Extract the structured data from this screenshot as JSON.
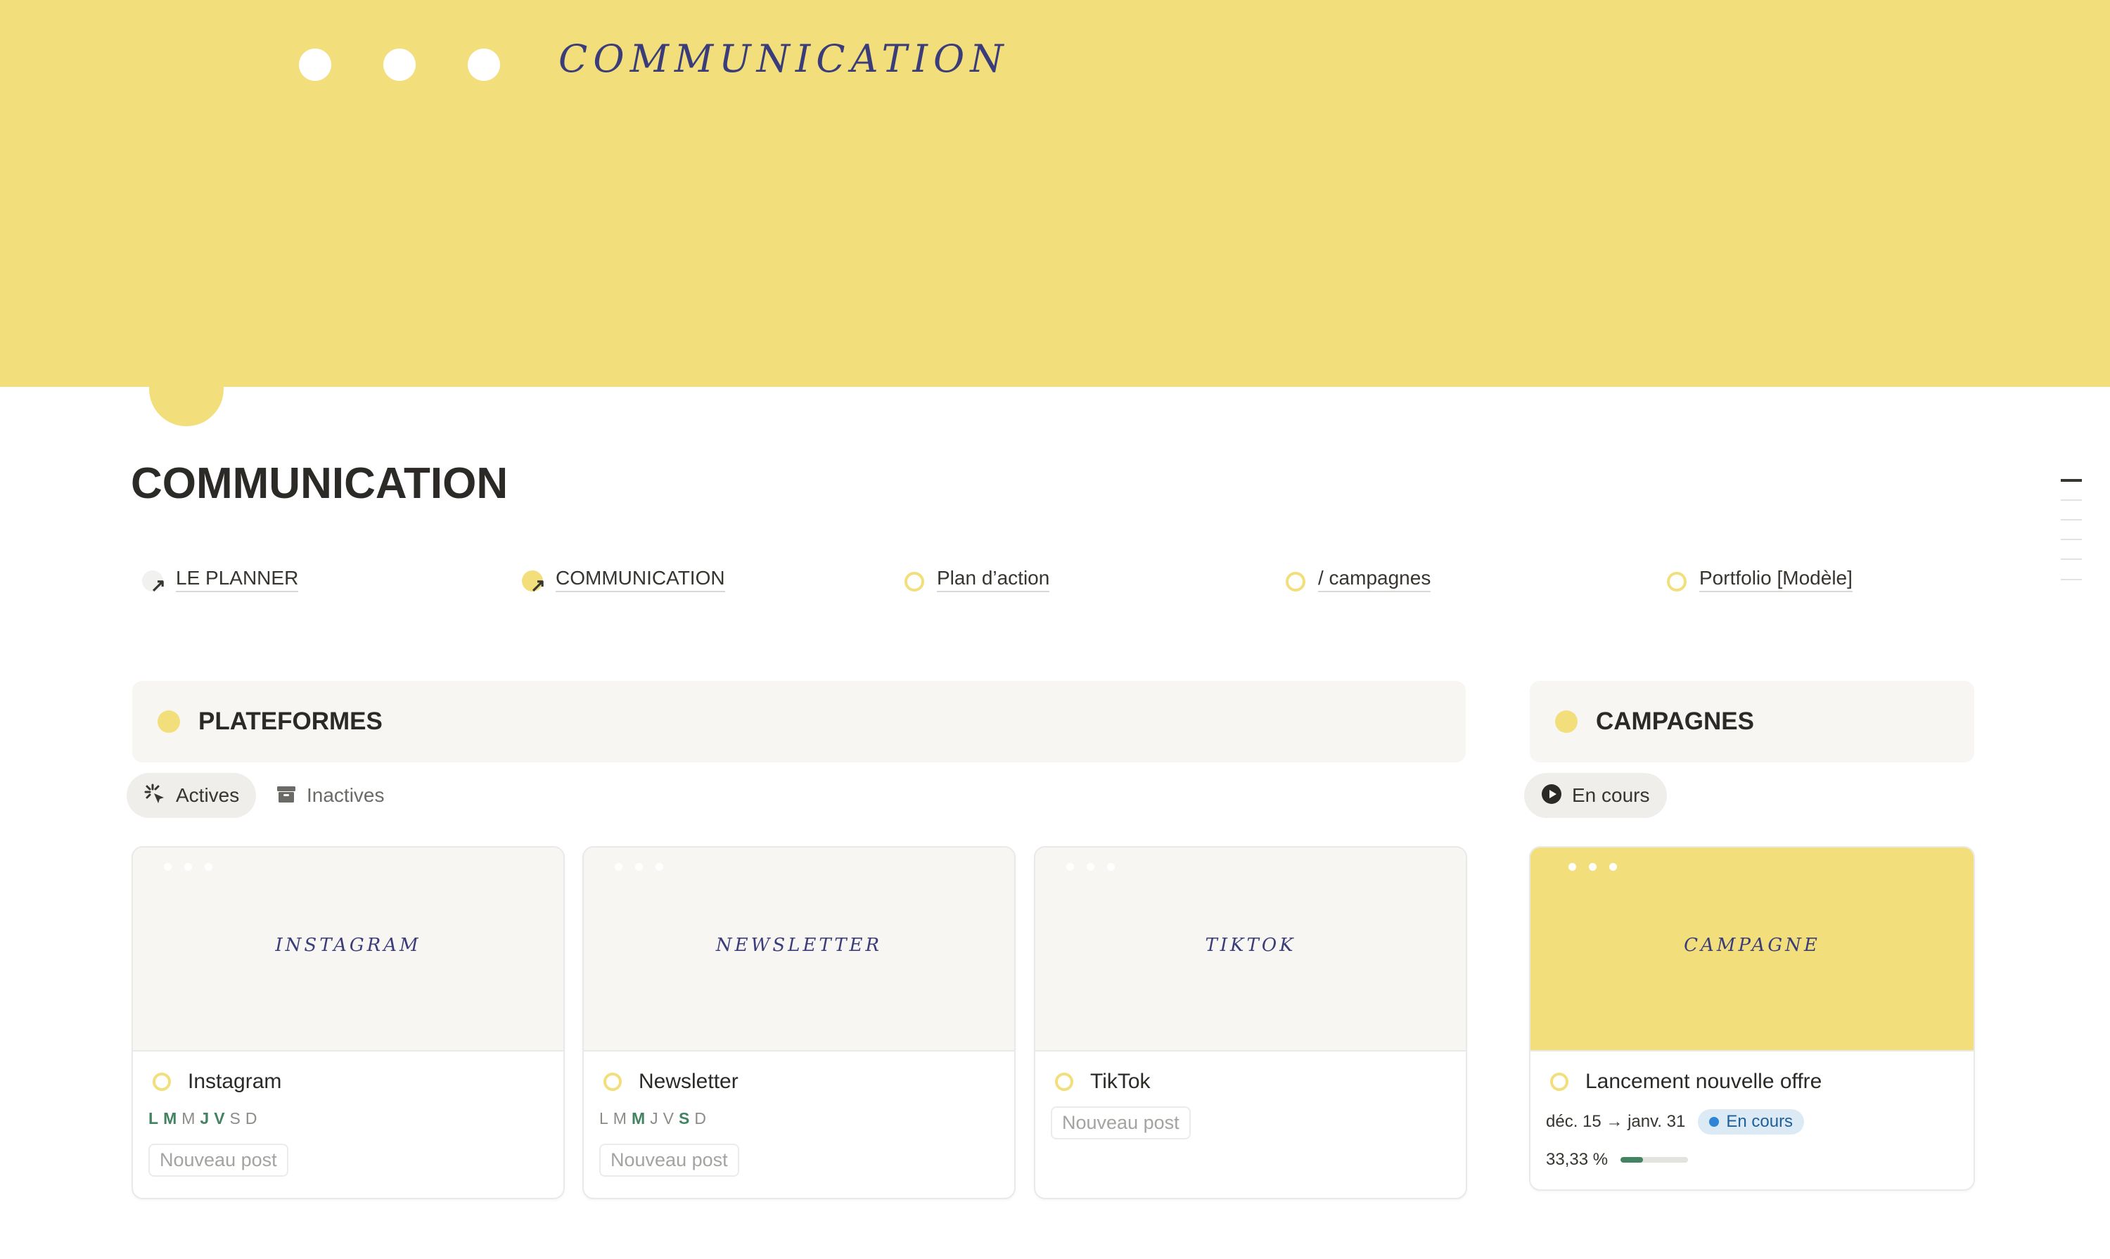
{
  "cover": {
    "title": "COMMUNICATION",
    "color": "#f2df7c"
  },
  "page": {
    "title": "COMMUNICATION"
  },
  "links": [
    {
      "label": "LE PLANNER",
      "icon": "link-arrow-icon"
    },
    {
      "label": "COMMUNICATION",
      "icon": "link-arrow-icon"
    },
    {
      "label": "Plan d’action",
      "icon": "page-ring-icon"
    },
    {
      "label": "/ campagnes",
      "icon": "page-ring-icon"
    },
    {
      "label": "Portfolio [Modèle]",
      "icon": "page-ring-icon"
    }
  ],
  "platforms": {
    "header": "PLATEFORMES",
    "tabs": [
      {
        "label": "Actives",
        "icon": "sparkle-cursor-icon",
        "selected": true
      },
      {
        "label": "Inactives",
        "icon": "archive-icon",
        "selected": false
      }
    ],
    "cards": [
      {
        "image_text": "INSTAGRAM",
        "name": "Instagram",
        "days": [
          {
            "d": "L",
            "on": true
          },
          {
            "d": "M",
            "on": true
          },
          {
            "d": "M",
            "on": false
          },
          {
            "d": "J",
            "on": true
          },
          {
            "d": "V",
            "on": true
          },
          {
            "d": "S",
            "on": false
          },
          {
            "d": "D",
            "on": false
          }
        ],
        "new_post": "Nouveau post"
      },
      {
        "image_text": "NEWSLETTER",
        "name": "Newsletter",
        "days": [
          {
            "d": "L",
            "on": false
          },
          {
            "d": "M",
            "on": false
          },
          {
            "d": "M",
            "on": true
          },
          {
            "d": "J",
            "on": false
          },
          {
            "d": "V",
            "on": false
          },
          {
            "d": "S",
            "on": true
          },
          {
            "d": "D",
            "on": false
          }
        ],
        "new_post": "Nouveau post"
      },
      {
        "image_text": "TIKTOK",
        "name": "TikTok",
        "days": [],
        "new_post": "Nouveau post"
      }
    ]
  },
  "campaigns": {
    "header": "CAMPAGNES",
    "tab": {
      "label": "En cours",
      "icon": "play-circle-icon"
    },
    "card": {
      "image_text": "CAMPAGNE",
      "name": "Lancement nouvelle offre",
      "dates": "déc. 15 → janv. 31",
      "status": "En cours",
      "status_color": "#2e84d6",
      "progress_label": "33,33 %",
      "progress": 0.3333
    }
  },
  "colors": {
    "accent_yellow": "#f2df7c",
    "active_day_green": "#448361",
    "handwriting_blue": "#3b3d7a"
  }
}
